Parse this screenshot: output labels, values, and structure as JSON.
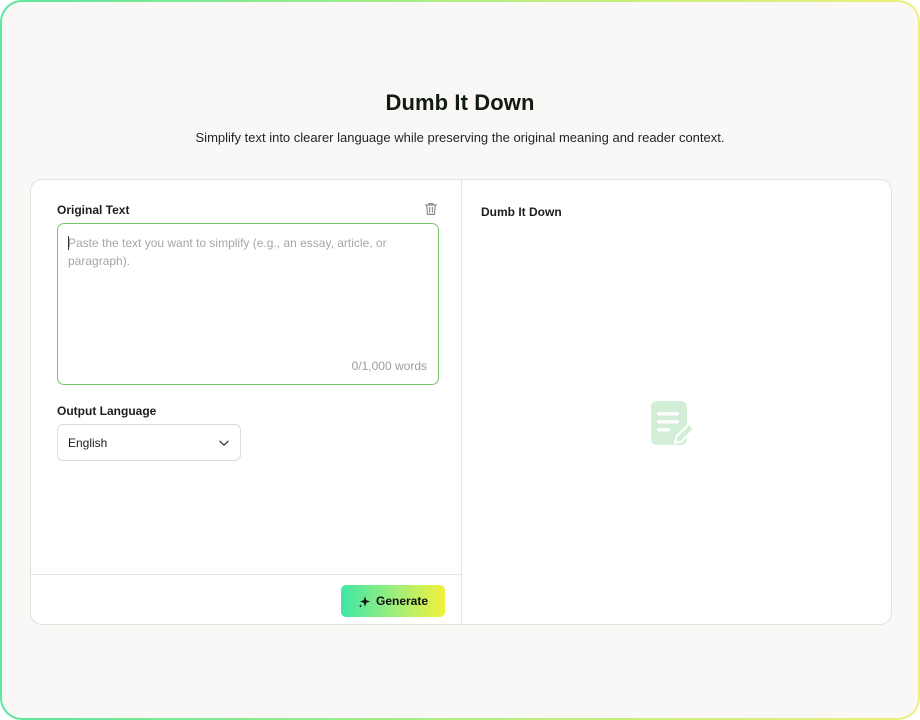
{
  "header": {
    "title": "Dumb It Down",
    "subtitle": "Simplify text into clearer language while preserving the original meaning and reader context."
  },
  "input_panel": {
    "original_text_label": "Original Text",
    "textarea_value": "",
    "textarea_placeholder": "Paste the text you want to simplify (e.g., an essay, article, or paragraph).",
    "word_count": "0/1,000 words",
    "clear_icon": "trash-icon",
    "output_language_label": "Output Language",
    "output_language_selected": "English",
    "dropdown_icon": "chevron-down-icon",
    "generate_label": "Generate",
    "generate_icon": "sparkle-icon"
  },
  "output_panel": {
    "title": "Dumb It Down",
    "empty_state_icon": "document-edit-icon"
  },
  "colors": {
    "frame_gradient_start": "#5ce6a0",
    "frame_gradient_end": "#eef07a",
    "textarea_border": "#7cc46a",
    "button_gradient_start": "#3fe6a6",
    "button_gradient_end": "#f1f03a",
    "empty_icon": "#d3eed7",
    "background": "#f9f8f6"
  }
}
